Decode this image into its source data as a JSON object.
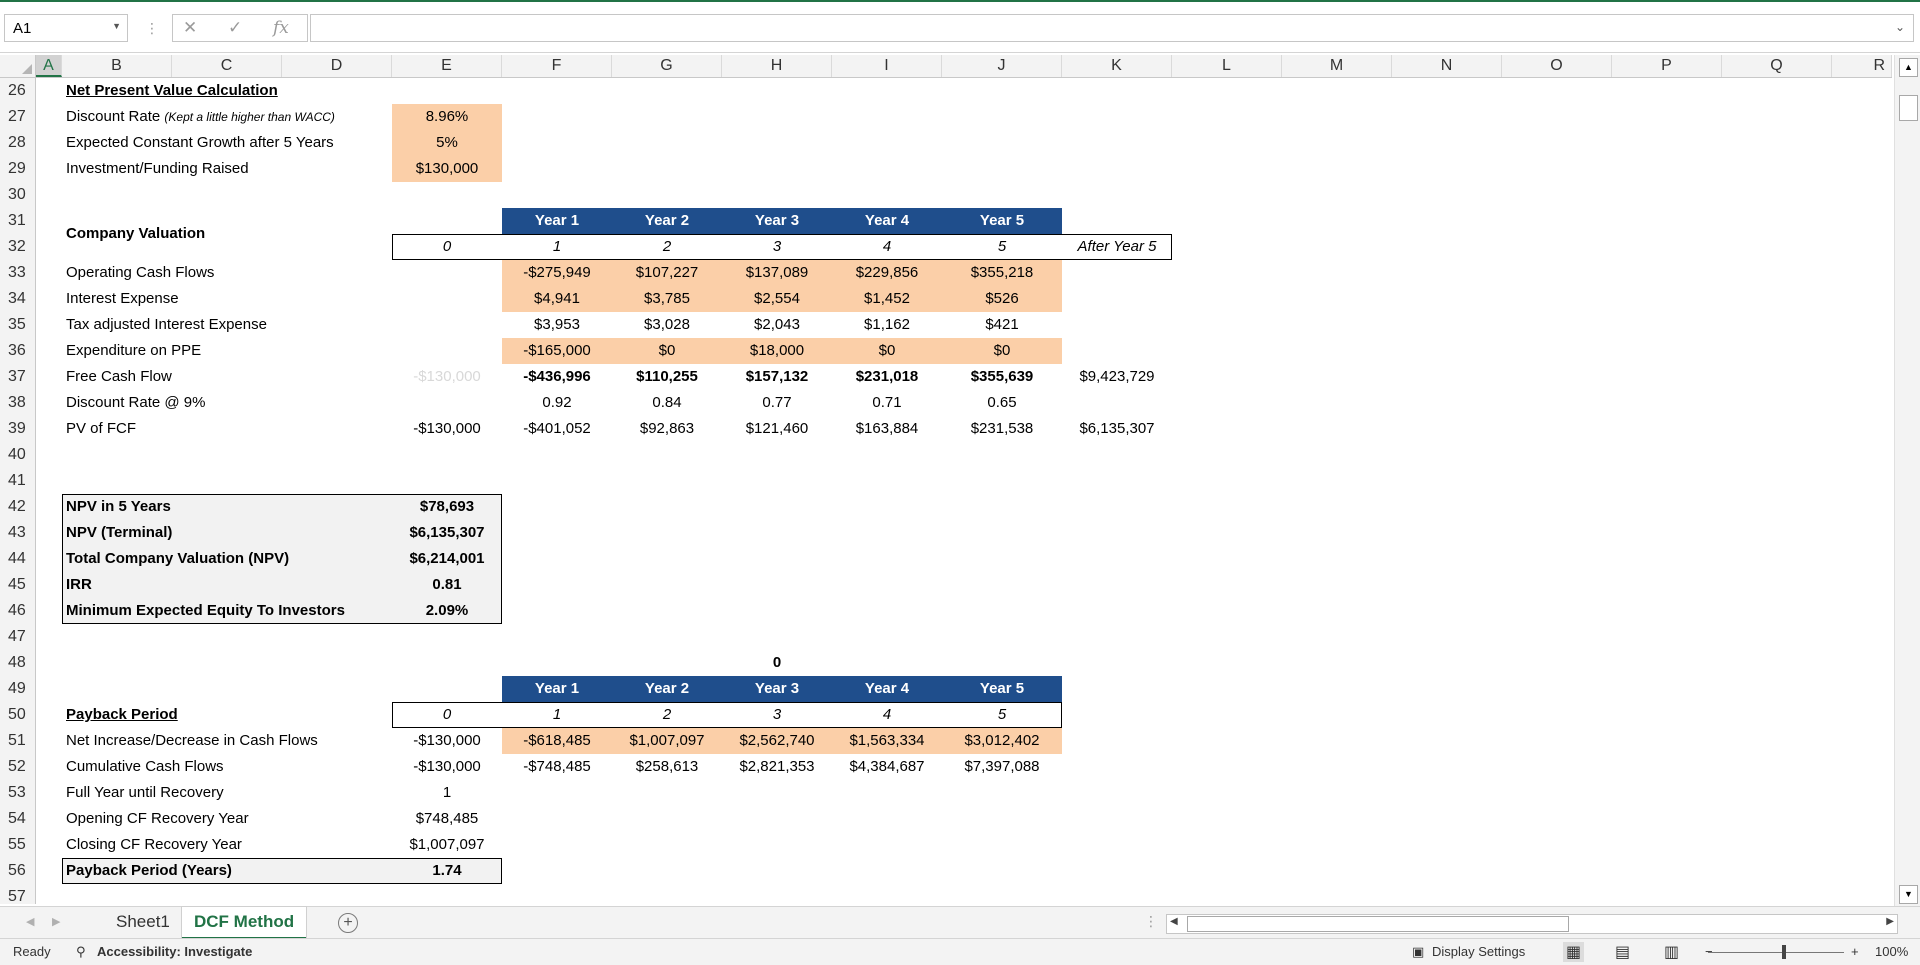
{
  "formula_bar": {
    "name_box": "A1",
    "formula": ""
  },
  "columns": [
    "A",
    "B",
    "C",
    "D",
    "E",
    "F",
    "G",
    "H",
    "I",
    "J",
    "K",
    "L",
    "M",
    "N",
    "O",
    "P",
    "Q",
    "R"
  ],
  "rows": [
    "26",
    "27",
    "28",
    "29",
    "30",
    "31",
    "32",
    "33",
    "34",
    "35",
    "36",
    "37",
    "38",
    "39",
    "40",
    "41",
    "42",
    "43",
    "44",
    "45",
    "46",
    "47",
    "48",
    "49",
    "50",
    "51",
    "52",
    "53",
    "54",
    "55",
    "56",
    "57"
  ],
  "npv_section": {
    "title": "Net Present Value Calculation",
    "discount_rate_label": "Discount Rate",
    "discount_rate_note": "(Kept a little higher than WACC)",
    "discount_rate": "8.96%",
    "growth_label": "Expected Constant Growth after 5 Years",
    "growth": "5%",
    "investment_label": "Investment/Funding Raised",
    "investment": "$130,000"
  },
  "valuation": {
    "title": "Company Valuation",
    "year_headers": [
      "Year 1",
      "Year 2",
      "Year 3",
      "Year 4",
      "Year 5"
    ],
    "periods": [
      "0",
      "1",
      "2",
      "3",
      "4",
      "5",
      "After Year 5"
    ],
    "rows": [
      {
        "label": "Operating Cash Flows",
        "e": "",
        "values": [
          "-$275,949",
          "$107,227",
          "$137,089",
          "$229,856",
          "$355,218"
        ],
        "k": ""
      },
      {
        "label": "Interest Expense",
        "e": "",
        "values": [
          "$4,941",
          "$3,785",
          "$2,554",
          "$1,452",
          "$526"
        ],
        "k": ""
      },
      {
        "label": "Tax adjusted Interest Expense",
        "e": "",
        "values": [
          "$3,953",
          "$3,028",
          "$2,043",
          "$1,162",
          "$421"
        ],
        "k": ""
      },
      {
        "label": "Expenditure on PPE",
        "e": "",
        "values": [
          "-$165,000",
          "$0",
          "$18,000",
          "$0",
          "$0"
        ],
        "k": ""
      },
      {
        "label": "Free Cash Flow",
        "e": "-$130,000",
        "values": [
          "-$436,996",
          "$110,255",
          "$157,132",
          "$231,018",
          "$355,639"
        ],
        "k": "$9,423,729"
      },
      {
        "label": "Discount Rate @ 9%",
        "e": "",
        "values": [
          "0.92",
          "0.84",
          "0.77",
          "0.71",
          "0.65"
        ],
        "k": ""
      },
      {
        "label": "PV of FCF",
        "e": "-$130,000",
        "values": [
          "-$401,052",
          "$92,863",
          "$121,460",
          "$163,884",
          "$231,538"
        ],
        "k": "$6,135,307"
      }
    ]
  },
  "summary": [
    {
      "label": "NPV in 5 Years",
      "value": "$78,693"
    },
    {
      "label": "NPV (Terminal)",
      "value": "$6,135,307"
    },
    {
      "label": "Total Company Valuation (NPV)",
      "value": "$6,214,001"
    },
    {
      "label": "IRR",
      "value": "0.81"
    },
    {
      "label": "Minimum Expected Equity To Investors",
      "value": "2.09%"
    }
  ],
  "payback": {
    "h48": "0",
    "title": "Payback Period",
    "year_headers": [
      "Year 1",
      "Year 2",
      "Year 3",
      "Year 4",
      "Year 5"
    ],
    "periods": [
      "0",
      "1",
      "2",
      "3",
      "4",
      "5"
    ],
    "net_label": "Net Increase/Decrease in Cash Flows",
    "net": [
      "-$130,000",
      "-$618,485",
      "$1,007,097",
      "$2,562,740",
      "$1,563,334",
      "$3,012,402"
    ],
    "cum_label": "Cumulative Cash Flows",
    "cum": [
      "-$130,000",
      "-$748,485",
      "$258,613",
      "$2,821,353",
      "$4,384,687",
      "$7,397,088"
    ],
    "full_year_label": "Full Year until Recovery",
    "full_year": "1",
    "opening_label": "Opening CF Recovery Year",
    "opening": "$748,485",
    "closing_label": "Closing CF Recovery Year",
    "closing": "$1,007,097",
    "result_label": "Payback Period (Years)",
    "result": "1.74"
  },
  "sheet_tabs": [
    "Sheet1",
    "DCF Method"
  ],
  "status": {
    "ready": "Ready",
    "accessibility": "Accessibility: Investigate",
    "display_settings": "Display Settings",
    "zoom": "100%"
  }
}
